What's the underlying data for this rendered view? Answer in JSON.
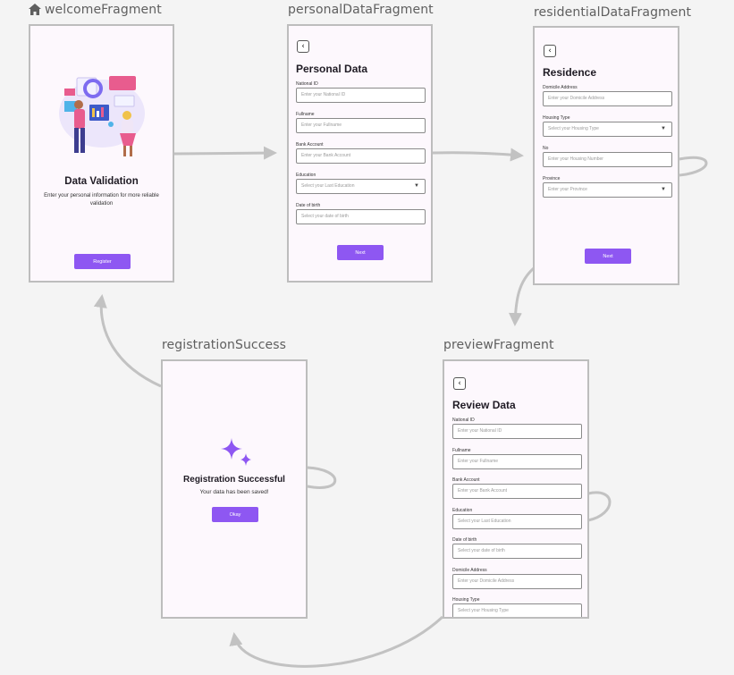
{
  "destinations": {
    "welcome": {
      "label": "welcomeFragment",
      "title": "Data Validation",
      "subtitle": "Enter your personal information for more reliable validation",
      "button": "Register"
    },
    "personal": {
      "label": "personalDataFragment",
      "title": "Personal Data",
      "fields": [
        {
          "label": "National ID",
          "placeholder": "Enter your National ID"
        },
        {
          "label": "Fullname",
          "placeholder": "Enter your Fullname"
        },
        {
          "label": "Bank Account",
          "placeholder": "Enter your Bank Account"
        },
        {
          "label": "Education",
          "placeholder": "Select your Last Education",
          "dropdown": true
        },
        {
          "label": "Date of birth",
          "placeholder": "Select your date of birth"
        }
      ],
      "button": "Next"
    },
    "residential": {
      "label": "residentialDataFragment",
      "title": "Residence",
      "fields": [
        {
          "label": "Domicile Address",
          "placeholder": "Enter your Domicile Address"
        },
        {
          "label": "Housing Type",
          "placeholder": "Select your Housing Type",
          "dropdown": true
        },
        {
          "label": "No",
          "placeholder": "Enter your Housing Number"
        },
        {
          "label": "Province",
          "placeholder": "Enter your Province",
          "dropdown": true
        }
      ],
      "button": "Next"
    },
    "preview": {
      "label": "previewFragment",
      "title": "Review Data",
      "fields": [
        {
          "label": "National ID",
          "placeholder": "Enter your National ID"
        },
        {
          "label": "Fullname",
          "placeholder": "Enter your Fullname"
        },
        {
          "label": "Bank Account",
          "placeholder": "Enter your Bank Account"
        },
        {
          "label": "Education",
          "placeholder": "Select your Last Education"
        },
        {
          "label": "Date of birth",
          "placeholder": "Select your date of birth"
        },
        {
          "label": "Domicile Address",
          "placeholder": "Enter your Domicile Address"
        },
        {
          "label": "Housing Type",
          "placeholder": "Select your Housing Type"
        }
      ]
    },
    "success": {
      "label": "registrationSuccess",
      "title": "Registration Successful",
      "subtitle": "Your data has been saved!",
      "button": "Okay"
    }
  },
  "colors": {
    "accent": "#8e57f2",
    "edge": "#c2c2c2",
    "frame_border": "#bdbdbd",
    "screen_bg": "#fdf8fd"
  },
  "icons": [
    "home-icon",
    "back-arrow-icon",
    "sparkle-icon",
    "dropdown-arrow-icon"
  ]
}
